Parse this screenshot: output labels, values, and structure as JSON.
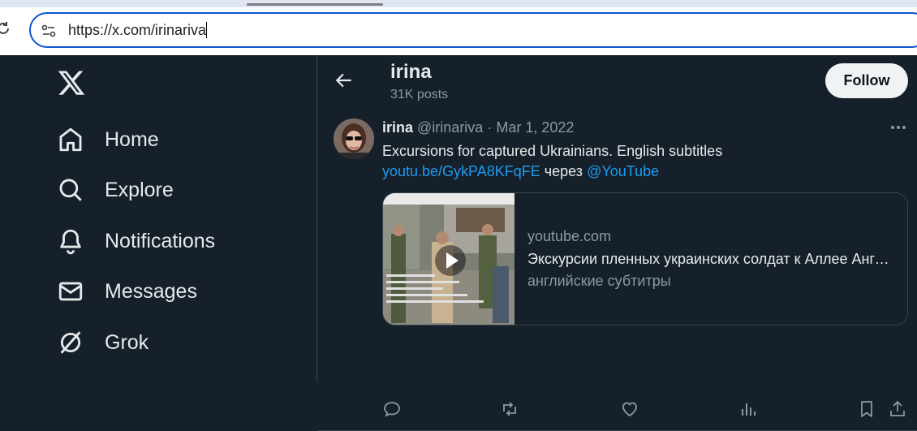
{
  "browser": {
    "url": "https://x.com/irinariva"
  },
  "sidebar": {
    "items": [
      {
        "label": "Home",
        "icon": "home-icon"
      },
      {
        "label": "Explore",
        "icon": "search-icon"
      },
      {
        "label": "Notifications",
        "icon": "bell-icon"
      },
      {
        "label": "Messages",
        "icon": "envelope-icon"
      },
      {
        "label": "Grok",
        "icon": "grok-icon"
      }
    ]
  },
  "profile": {
    "name": "irina",
    "posts": "31K posts",
    "follow_label": "Follow"
  },
  "tweet": {
    "author": "irina",
    "handle": "@irinariva",
    "separator": "·",
    "date": "Mar 1, 2022",
    "text": "Excursions for captured Ukrainians. English subtitles",
    "link": "youtu.be/GykPA8KFqFE",
    "via": "через",
    "mention": "@YouTube",
    "card": {
      "domain": "youtube.com",
      "title": "Экскурсии пленных украинских солдат к Аллее Ангелов",
      "description": "английские субтитры"
    }
  },
  "colors": {
    "background": "#15202b",
    "link": "#1d9bf0",
    "text": "#e7e9ea",
    "muted": "#8b98a5",
    "border": "#38444d"
  }
}
